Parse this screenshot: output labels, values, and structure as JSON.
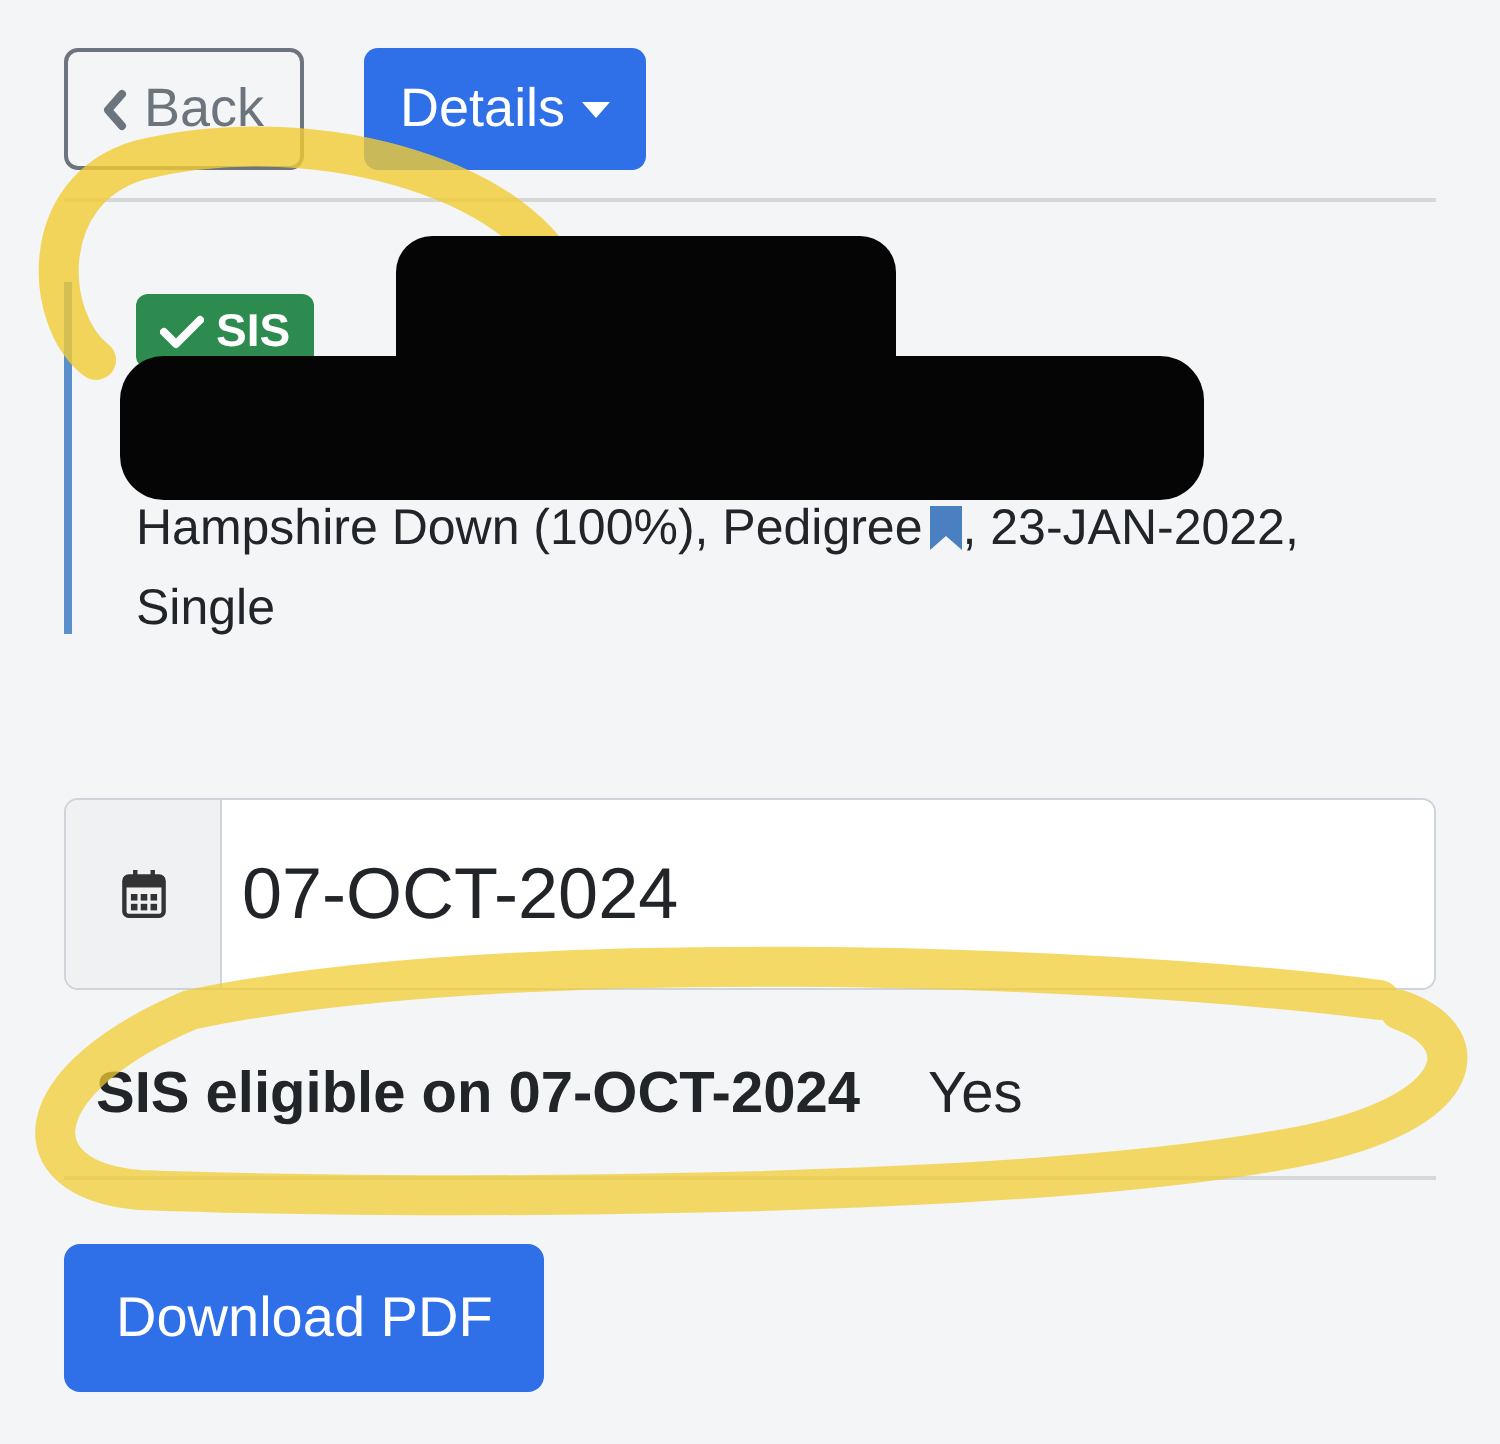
{
  "toolbar": {
    "back_button": "Back",
    "details_button": "Details"
  },
  "animal": {
    "badge": "SIS",
    "details_before_icon": "Hampshire Down (100%), Pedigree",
    "details_after_icon": ", 23-JAN-2022, Single"
  },
  "date_field": {
    "value": "07-OCT-2024"
  },
  "result": {
    "label": "SIS eligible on 07-OCT-2024",
    "value": "Yes"
  },
  "download_button": "Download PDF"
}
